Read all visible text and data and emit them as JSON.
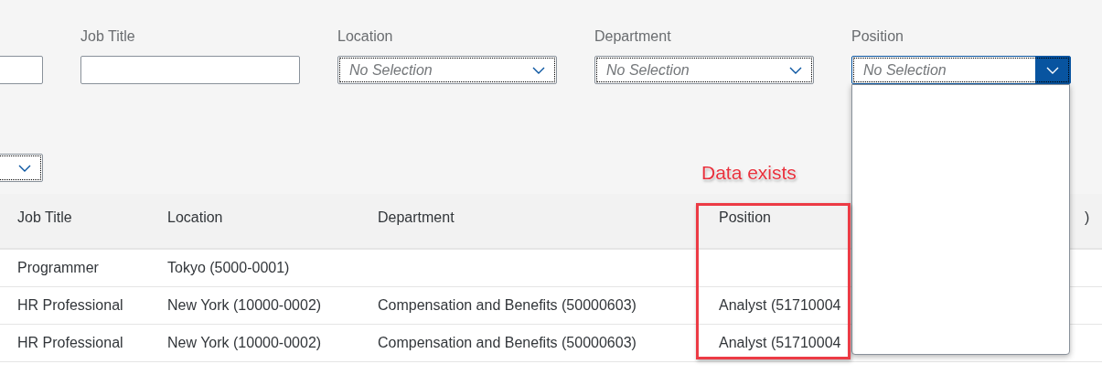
{
  "filters": {
    "rows": [
      [
        {
          "kind": "text"
        },
        {
          "kind": "text",
          "label": "Job Title"
        },
        {
          "kind": "select",
          "label": "Location",
          "placeholder": "No Selection",
          "expanded": false
        },
        {
          "kind": "select",
          "label": "Department",
          "placeholder": "No Selection",
          "expanded": false
        },
        {
          "kind": "select",
          "label": "Position",
          "placeholder": "No Selection",
          "expanded": true
        }
      ],
      [
        {
          "kind": "select",
          "expanded": false
        }
      ]
    ]
  },
  "table": {
    "columns": [
      "Job Title",
      "Location",
      "Department",
      "Position",
      ")"
    ],
    "rows": [
      [
        "Programmer",
        "Tokyo (5000-0001)",
        "",
        ""
      ],
      [
        "HR Professional",
        "New York (10000-0002)",
        "Compensation and Benefits (50000603)",
        "Analyst (51710004"
      ],
      [
        "HR Professional",
        "New York (10000-0002)",
        "Compensation and Benefits (50000603)",
        "Analyst (51710004"
      ]
    ]
  },
  "annotation": {
    "text": "Data exists"
  }
}
